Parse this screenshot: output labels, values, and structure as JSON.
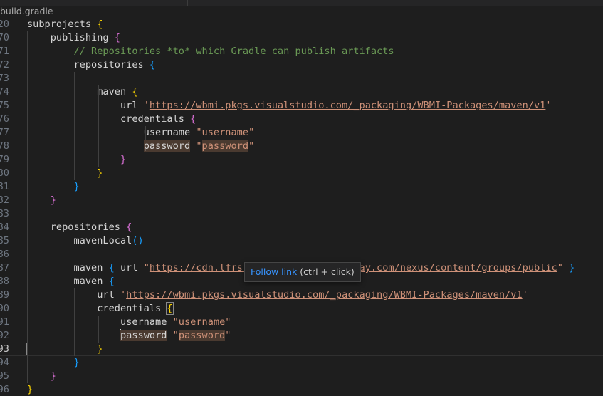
{
  "tab": {
    "filename": "build.gradle"
  },
  "hover": {
    "link_text": "Follow link",
    "hint": "(ctrl + click)"
  },
  "lines": [
    {
      "n": "20",
      "seg": [
        [
          "kw",
          "subprojects "
        ],
        [
          "b1",
          "{"
        ]
      ]
    },
    {
      "n": "70",
      "seg": [
        [
          "kw",
          "    publishing "
        ],
        [
          "b2",
          "{"
        ]
      ]
    },
    {
      "n": "71",
      "seg": [
        [
          "cmt",
          "        // Repositories *to* which Gradle can publish artifacts"
        ]
      ]
    },
    {
      "n": "72",
      "seg": [
        [
          "kw",
          "        repositories "
        ],
        [
          "b3",
          "{"
        ]
      ]
    },
    {
      "n": "73",
      "seg": []
    },
    {
      "n": "74",
      "seg": [
        [
          "kw",
          "            maven "
        ],
        [
          "b1",
          "{"
        ]
      ]
    },
    {
      "n": "75",
      "seg": [
        [
          "kw",
          "                url "
        ],
        [
          "str",
          "'"
        ],
        [
          "link",
          "https://wbmi.pkgs.visualstudio.com/_packaging/WBMI-Packages/maven/v1"
        ],
        [
          "str",
          "'"
        ]
      ]
    },
    {
      "n": "76",
      "seg": [
        [
          "kw",
          "                credentials "
        ],
        [
          "b2",
          "{"
        ]
      ]
    },
    {
      "n": "77",
      "seg": [
        [
          "kw",
          "                    username "
        ],
        [
          "str",
          "\"username\""
        ]
      ]
    },
    {
      "n": "78",
      "seg": [
        [
          "kw",
          "                    "
        ],
        [
          "hl",
          "password"
        ],
        [
          "kw",
          " "
        ],
        [
          "str",
          "\""
        ],
        [
          "strhl",
          "password"
        ],
        [
          "str",
          "\""
        ]
      ]
    },
    {
      "n": "79",
      "seg": [
        [
          "b2",
          "                }"
        ]
      ]
    },
    {
      "n": "80",
      "seg": [
        [
          "b1",
          "            }"
        ]
      ]
    },
    {
      "n": "81",
      "seg": [
        [
          "b3",
          "        }"
        ]
      ]
    },
    {
      "n": "82",
      "seg": [
        [
          "b2",
          "    }"
        ]
      ]
    },
    {
      "n": "83",
      "seg": []
    },
    {
      "n": "84",
      "seg": [
        [
          "kw",
          "    repositories "
        ],
        [
          "b2",
          "{"
        ]
      ]
    },
    {
      "n": "85",
      "seg": [
        [
          "kw",
          "        mavenLocal"
        ],
        [
          "b3",
          "()"
        ]
      ]
    },
    {
      "n": "86",
      "seg": []
    },
    {
      "n": "87",
      "seg": [
        [
          "kw",
          "        maven "
        ],
        [
          "b3",
          "{"
        ],
        [
          "kw",
          " url "
        ],
        [
          "str",
          "\""
        ],
        [
          "link",
          "https://cdn.lfrs.sl/repository.liferay.com/nexus/content/groups/public"
        ],
        [
          "str",
          "\""
        ],
        [
          "kw",
          " "
        ],
        [
          "b3",
          "}"
        ]
      ]
    },
    {
      "n": "88",
      "seg": [
        [
          "kw",
          "        maven "
        ],
        [
          "b3",
          "{"
        ]
      ]
    },
    {
      "n": "89",
      "seg": [
        [
          "kw",
          "            url "
        ],
        [
          "str",
          "'"
        ],
        [
          "link",
          "https://wbmi.pkgs.visualstudio.com/_packaging/WBMI-Packages/maven/v1"
        ],
        [
          "str",
          "'"
        ]
      ]
    },
    {
      "n": "90",
      "seg": [
        [
          "kw",
          "            credentials "
        ],
        [
          "b1m",
          "{"
        ]
      ]
    },
    {
      "n": "91",
      "seg": [
        [
          "kw",
          "                username "
        ],
        [
          "str",
          "\"username\""
        ]
      ]
    },
    {
      "n": "92",
      "seg": [
        [
          "kw",
          "                "
        ],
        [
          "cursor",
          ""
        ],
        [
          "hl",
          "password"
        ],
        [
          "kw",
          " "
        ],
        [
          "str",
          "\""
        ],
        [
          "strhl",
          "password"
        ],
        [
          "str",
          "\""
        ]
      ]
    },
    {
      "n": "93",
      "seg": [
        [
          "b1m",
          "            }"
        ]
      ]
    },
    {
      "n": "94",
      "seg": [
        [
          "b3",
          "        }"
        ]
      ]
    },
    {
      "n": "95",
      "seg": [
        [
          "b2",
          "    }"
        ]
      ]
    },
    {
      "n": "96",
      "seg": [
        [
          "b1",
          "}"
        ]
      ]
    }
  ]
}
